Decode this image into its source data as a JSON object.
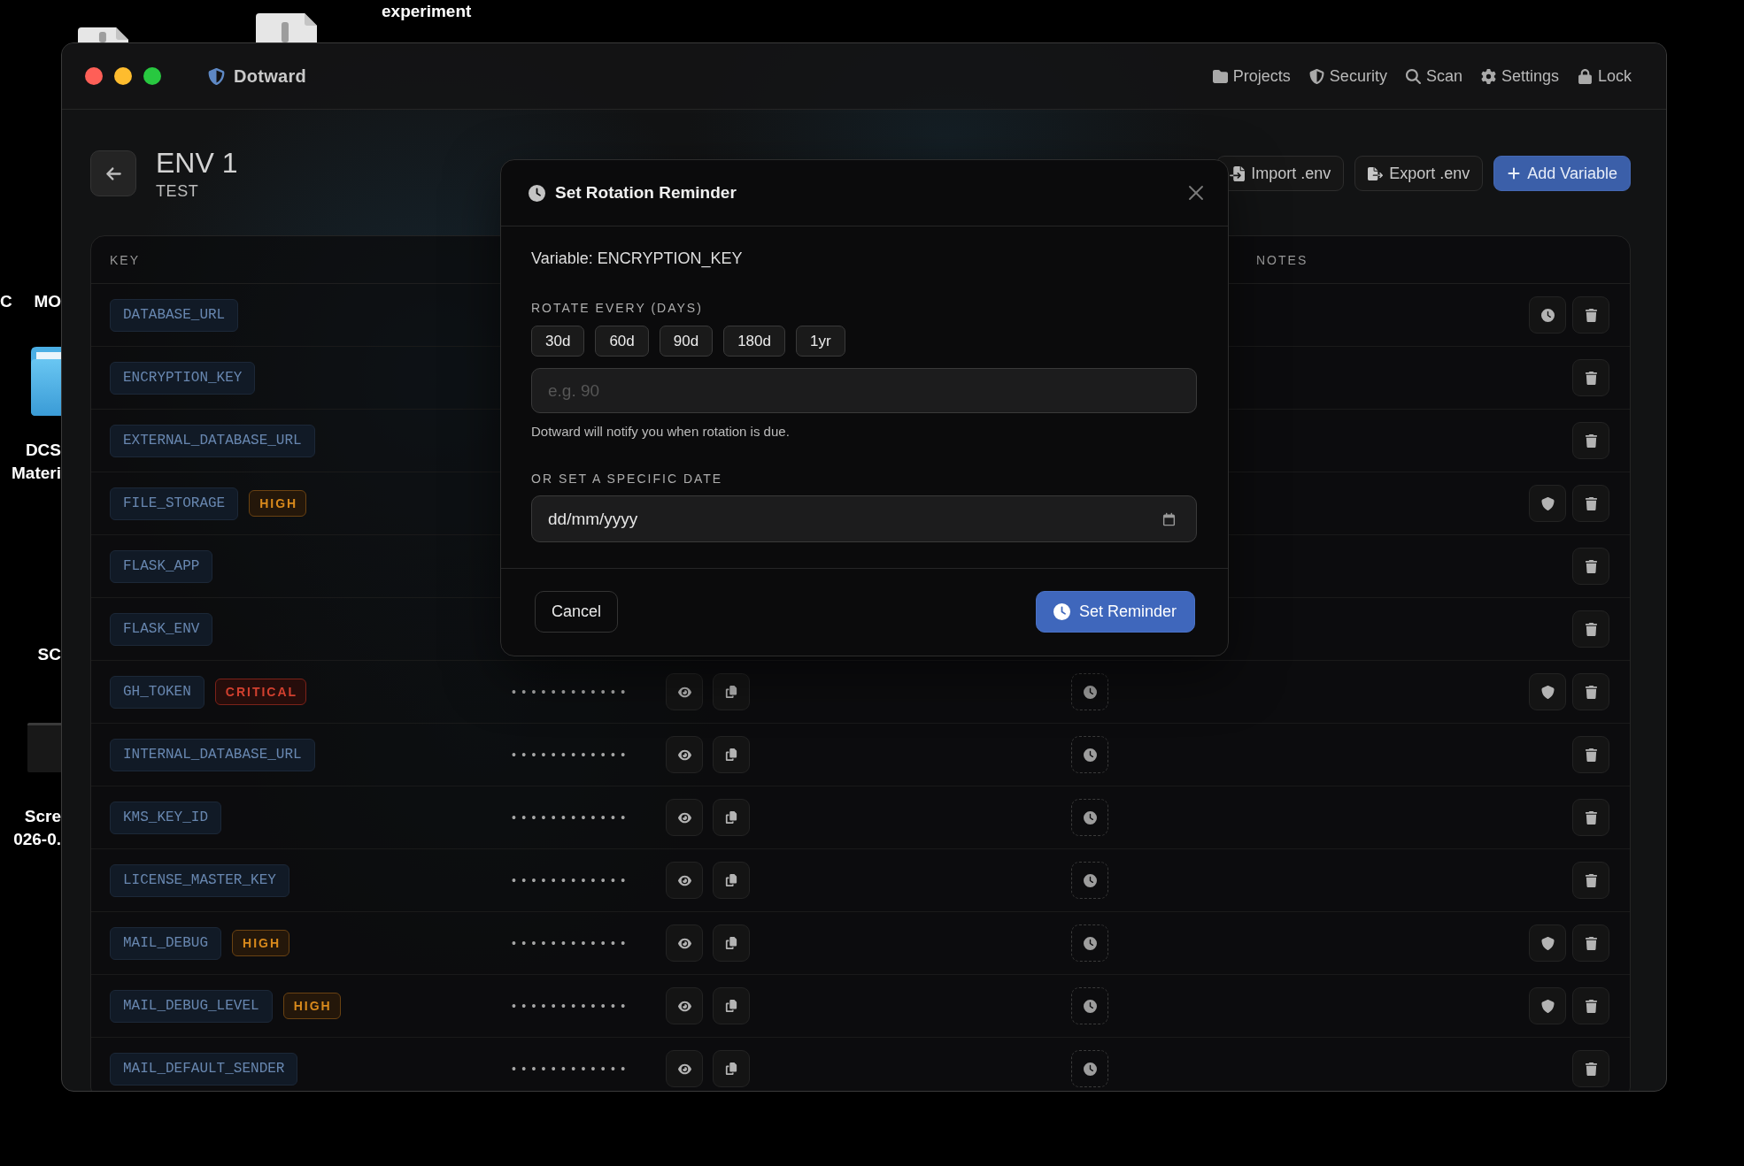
{
  "desktop": {
    "items": [
      {
        "kind": "label",
        "lines": [
          "experiment"
        ]
      },
      {
        "kind": "file"
      },
      {
        "kind": "file"
      },
      {
        "kind": "label",
        "lines": [
          "C"
        ]
      },
      {
        "kind": "label",
        "lines": [
          "MO"
        ]
      },
      {
        "kind": "folder",
        "lines": [
          "DCS",
          "Materi"
        ]
      },
      {
        "kind": "label",
        "lines": [
          "SC"
        ]
      },
      {
        "kind": "screenshot",
        "lines": [
          "Scre",
          "026-0."
        ]
      }
    ]
  },
  "window": {
    "title": "Dotward",
    "nav": [
      "Projects",
      "Security",
      "Scan",
      "Settings",
      "Lock"
    ]
  },
  "page": {
    "title": "ENV 1",
    "subtitle": "TEST",
    "actions": [
      {
        "kind": "import",
        "label": "Import .env"
      },
      {
        "kind": "export",
        "label": "Export .env"
      },
      {
        "kind": "add",
        "label": "Add Variable"
      }
    ]
  },
  "table": {
    "columns": {
      "key": "KEY",
      "notes": "NOTES"
    },
    "rows": [
      {
        "key": "DATABASE_URL",
        "actions": [
          {
            "kind": "reminder"
          },
          {
            "kind": "delete"
          }
        ]
      },
      {
        "key": "ENCRYPTION_KEY",
        "actions": [
          {
            "kind": "delete"
          }
        ]
      },
      {
        "key": "EXTERNAL_DATABASE_URL",
        "actions": [
          {
            "kind": "delete"
          }
        ]
      },
      {
        "key": "FILE_STORAGE",
        "risk": {
          "kind": "high",
          "label": "HIGH"
        },
        "actions": [
          {
            "kind": "security"
          },
          {
            "kind": "delete"
          }
        ]
      },
      {
        "key": "FLASK_APP",
        "actions": [
          {
            "kind": "delete"
          }
        ]
      },
      {
        "key": "FLASK_ENV",
        "actions": [
          {
            "kind": "delete"
          }
        ]
      },
      {
        "key": "GH_TOKEN",
        "risk": {
          "kind": "critical",
          "label": "CRITICAL"
        },
        "value": "••••••••••••",
        "actions": [
          {
            "kind": "security"
          },
          {
            "kind": "delete"
          }
        ]
      },
      {
        "key": "INTERNAL_DATABASE_URL",
        "value": "••••••••••••",
        "actions": [
          {
            "kind": "delete"
          }
        ]
      },
      {
        "key": "KMS_KEY_ID",
        "value": "••••••••••••",
        "actions": [
          {
            "kind": "delete"
          }
        ]
      },
      {
        "key": "LICENSE_MASTER_KEY",
        "value": "••••••••••••",
        "actions": [
          {
            "kind": "delete"
          }
        ]
      },
      {
        "key": "MAIL_DEBUG",
        "risk": {
          "kind": "high",
          "label": "HIGH"
        },
        "value": "••••••••••••",
        "actions": [
          {
            "kind": "security"
          },
          {
            "kind": "delete"
          }
        ]
      },
      {
        "key": "MAIL_DEBUG_LEVEL",
        "risk": {
          "kind": "high",
          "label": "HIGH"
        },
        "value": "••••••••••••",
        "actions": [
          {
            "kind": "security"
          },
          {
            "kind": "delete"
          }
        ]
      },
      {
        "key": "MAIL_DEFAULT_SENDER",
        "value": "••••••••••••",
        "actions": [
          {
            "kind": "delete"
          }
        ]
      }
    ]
  },
  "modal": {
    "title": "Set Rotation Reminder",
    "variable": "Variable: ENCRYPTION_KEY",
    "rotate_label": "ROTATE EVERY (DAYS)",
    "presets": [
      {
        "label": "30d",
        "selected": false
      },
      {
        "label": "60d",
        "selected": false
      },
      {
        "label": "90d",
        "selected": false
      },
      {
        "label": "180d",
        "selected": false
      },
      {
        "label": "1yr",
        "selected": false
      }
    ],
    "days_field": {
      "placeholder": "e.g. 90"
    },
    "hint": "Dotward will notify you when rotation is due.",
    "date_label": "OR SET A SPECIFIC DATE",
    "date_field": {
      "placeholder": "dd/mm/yyyy"
    },
    "buttons": [
      {
        "kind": "cancel",
        "label": "Cancel"
      },
      {
        "kind": "confirm",
        "label": "Set Reminder"
      }
    ]
  }
}
